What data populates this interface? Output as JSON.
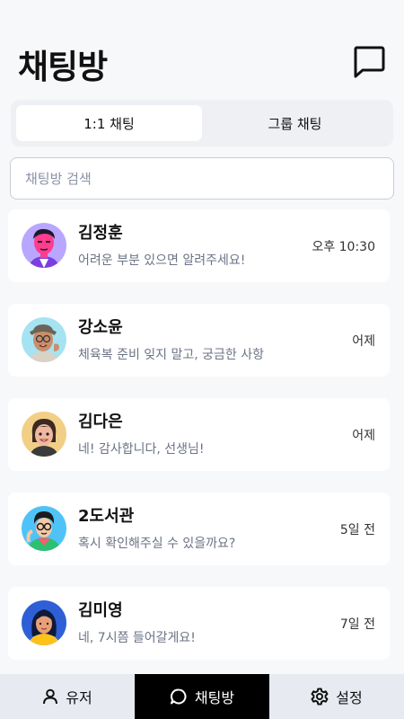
{
  "header": {
    "title": "채팅방",
    "new_chat_icon": "chat-bubble-icon"
  },
  "tabs": [
    {
      "label": "1:1 채팅",
      "active": true
    },
    {
      "label": "그룹 채팅",
      "active": false
    }
  ],
  "search": {
    "placeholder": "채팅방 검색",
    "value": ""
  },
  "chats": [
    {
      "name": "김정훈",
      "message": "어려운 부분 있으면 알려주세요!",
      "time": "오후 10:30",
      "avatar_bg": "#b9a7ff"
    },
    {
      "name": "강소윤",
      "message": "체육복 준비 잊지 말고, 궁금한 사항",
      "time": "어제",
      "avatar_bg": "#a6e3f2"
    },
    {
      "name": "김다은",
      "message": "네! 감사합니다, 선생님!",
      "time": "어제",
      "avatar_bg": "#f2cf86"
    },
    {
      "name": "2도서관",
      "message": "혹시 확인해주실 수 있을까요?",
      "time": "5일 전",
      "avatar_bg": "#4fc3f7"
    },
    {
      "name": "김미영",
      "message": "네, 7시쯤 들어갈게요!",
      "time": "7일 전",
      "avatar_bg": "#2f5fd6"
    }
  ],
  "bottom_nav": [
    {
      "label": "유저",
      "icon": "user-icon",
      "active": false
    },
    {
      "label": "채팅방",
      "icon": "chat-bubble-icon",
      "active": true
    },
    {
      "label": "설정",
      "icon": "gear-icon",
      "active": false
    }
  ]
}
